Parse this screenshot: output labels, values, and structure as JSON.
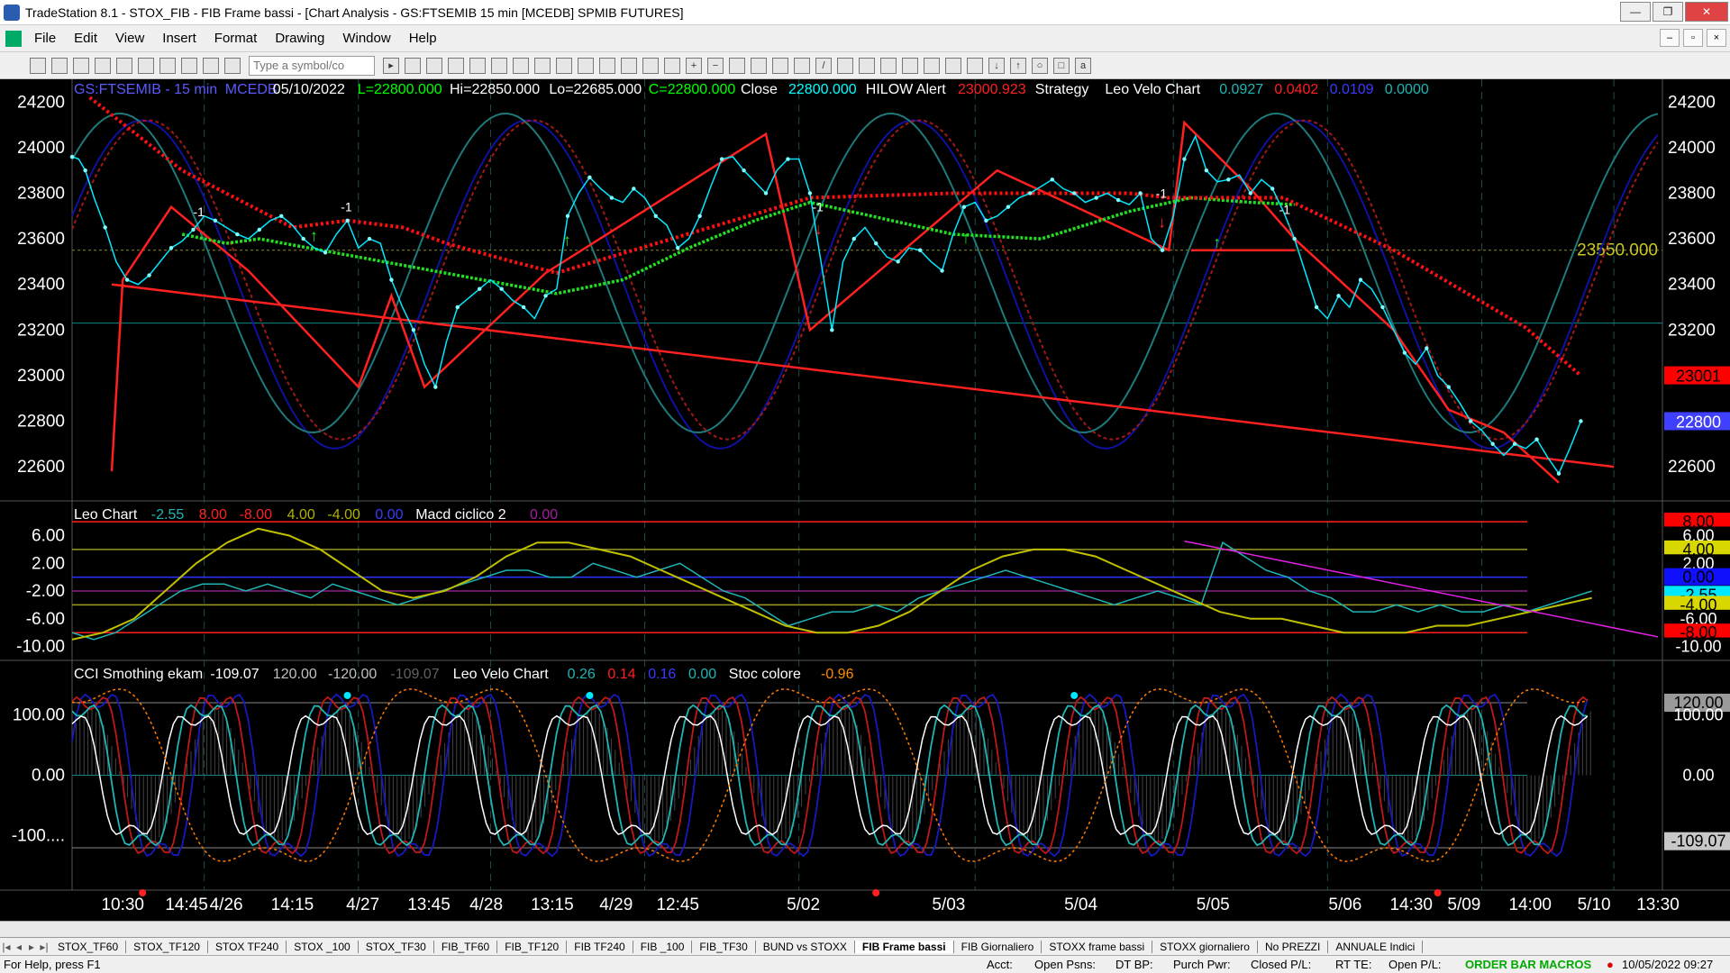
{
  "window": {
    "title": "TradeStation 8.1 - STOX_FIB - FIB Frame bassi - [Chart Analysis - GS:FTSEMIB 15 min  [MCEDB] SPMIB FUTURES]",
    "min_label": "—",
    "max_label": "❐",
    "close_label": "✕"
  },
  "menu": [
    "File",
    "Edit",
    "View",
    "Insert",
    "Format",
    "Drawing",
    "Window",
    "Help"
  ],
  "toolbar": {
    "symbol_placeholder": "Type a symbol/co"
  },
  "price_pane": {
    "header": [
      {
        "t": "GS:FTSEMIB - 15 min",
        "c": "#5a5aff"
      },
      {
        "t": "MCEDB",
        "c": "#5a5aff"
      },
      {
        "t": "05/10/2022",
        "c": "#ffffff"
      },
      {
        "t": "L=22800.000",
        "c": "#00ff00"
      },
      {
        "t": "Hi=22850.000",
        "c": "#ffffff"
      },
      {
        "t": "Lo=22685.000",
        "c": "#ffffff"
      },
      {
        "t": "C=22800.000",
        "c": "#00ff00"
      },
      {
        "t": "Close",
        "c": "#ffffff"
      },
      {
        "t": "22800.000",
        "c": "#00ffff"
      },
      {
        "t": "HILOW Alert",
        "c": "#ffffff"
      },
      {
        "t": "23000.923",
        "c": "#ff2020"
      },
      {
        "t": "Strategy",
        "c": "#ffffff"
      },
      {
        "t": "Leo Velo Chart",
        "c": "#ffffff"
      },
      {
        "t": "0.0927",
        "c": "#1fb5b5"
      },
      {
        "t": "0.0402",
        "c": "#ff2020"
      },
      {
        "t": "0.0109",
        "c": "#3a3aff"
      },
      {
        "t": "0.0000",
        "c": "#1fb5b5"
      }
    ],
    "y_ticks": [
      "24200",
      "24000",
      "23800",
      "23600",
      "23400",
      "23200",
      "23000",
      "22800",
      "22600"
    ],
    "y_range": [
      22450,
      24300
    ],
    "level_label": "23550.000",
    "level_value": 23550,
    "marker_hilow": "23001",
    "marker_close": "22800"
  },
  "osc_pane": {
    "header": [
      {
        "t": "Leo Chart",
        "c": "#ffffff"
      },
      {
        "t": "-2.55",
        "c": "#1fb5b5"
      },
      {
        "t": "8.00",
        "c": "#ff2020"
      },
      {
        "t": "-8.00",
        "c": "#ff2020"
      },
      {
        "t": "4.00",
        "c": "#b0b000"
      },
      {
        "t": "-4.00",
        "c": "#b0b000"
      },
      {
        "t": "0.00",
        "c": "#3a3aff"
      },
      {
        "t": "Macd ciclico 2",
        "c": "#ffffff"
      },
      {
        "t": "0.00",
        "c": "#a020a0"
      }
    ],
    "y_ticks": [
      "6.00",
      "2.00",
      "-2.00",
      "-6.00",
      "-10.00"
    ],
    "y_range": [
      -12,
      11
    ],
    "right_tags": [
      {
        "t": "8.00",
        "bg": "#ff0000",
        "fg": "#000000",
        "v": 8
      },
      {
        "t": "6.00",
        "bg": "#000000",
        "fg": "#ffffff",
        "v": 6
      },
      {
        "t": "4.00",
        "bg": "#d8d800",
        "fg": "#000000",
        "v": 4
      },
      {
        "t": "2.00",
        "bg": "#000000",
        "fg": "#ffffff",
        "v": 2
      },
      {
        "t": "0.00",
        "bg": "#1010ff",
        "fg": "#000000",
        "v": 0
      },
      {
        "t": "-2.55",
        "bg": "#00e8ff",
        "fg": "#000000",
        "v": -2.55
      },
      {
        "t": "-4.00",
        "bg": "#d8d800",
        "fg": "#000000",
        "v": -4
      },
      {
        "t": "-6.00",
        "bg": "#000000",
        "fg": "#ffffff",
        "v": -6
      },
      {
        "t": "-8.00",
        "bg": "#ff0000",
        "fg": "#000000",
        "v": -8
      },
      {
        "t": "-10.00",
        "bg": "#000000",
        "fg": "#ffffff",
        "v": -10
      }
    ]
  },
  "cci_pane": {
    "header": [
      {
        "t": "CCI Smothing ekam",
        "c": "#ffffff"
      },
      {
        "t": "-109.07",
        "c": "#ffffff"
      },
      {
        "t": "120.00",
        "c": "#c0c0c0"
      },
      {
        "t": "-120.00",
        "c": "#c0c0c0"
      },
      {
        "t": "-109.07",
        "c": "#606060"
      },
      {
        "t": "Leo Velo Chart",
        "c": "#ffffff"
      },
      {
        "t": "0.26",
        "c": "#1fb5b5"
      },
      {
        "t": "0.14",
        "c": "#ff2020"
      },
      {
        "t": "0.16",
        "c": "#3a3aff"
      },
      {
        "t": "0.00",
        "c": "#1fb5b5"
      },
      {
        "t": "Stoc colore",
        "c": "#ffffff"
      },
      {
        "t": "-0.96",
        "c": "#ff8c00"
      }
    ],
    "y_ticks": [
      "100.00",
      "0.00",
      "-100...."
    ],
    "y_range": [
      -190,
      190
    ],
    "right_tags": [
      {
        "t": "120.00",
        "v": 120
      },
      {
        "t": "100.00",
        "v": 100
      },
      {
        "t": "0.00",
        "v": 0
      },
      {
        "t": "-109.07",
        "v": -109.07
      }
    ]
  },
  "x_labels": [
    "10:30",
    "14:45",
    "4/26",
    "14:15",
    "4/27",
    "13:45",
    "4/28",
    "13:15",
    "4/29",
    "12:45",
    "5/02",
    "5/03",
    "5/04",
    "5/05",
    "5/06",
    "14:30",
    "5/09",
    "14:00",
    "5/10",
    "13:30"
  ],
  "tabs": [
    "STOX_TF60",
    "STOX_TF120",
    "STOX TF240",
    "STOX _100",
    "STOX_TF30",
    "FIB_TF60",
    "FIB_TF120",
    "FIB TF240",
    "FIB _100",
    "FIB_TF30",
    "BUND vs STOXX",
    "FIB Frame bassi",
    "FIB Giornaliero",
    "STOXX frame bassi",
    "STOXX giornaliero",
    "No PREZZI",
    "ANNUALE Indici"
  ],
  "active_tab": "FIB Frame bassi",
  "status": {
    "help": "For Help, press F1",
    "acct": "Acct:",
    "open_psns": "Open Psns:",
    "dt_bp": "DT BP:",
    "purch_pwr": "Purch Pwr:",
    "closed_pl": "Closed P/L:",
    "rt_te": "RT TE:",
    "open_pl": "Open P/L:",
    "macros": "ORDER BAR  MACROS",
    "datetime": "10/05/2022 09:27"
  },
  "chart_data": {
    "type": "line",
    "symbol": "GS:FTSEMIB",
    "price_close_path": [
      [
        0,
        23960
      ],
      [
        0.3,
        23950
      ],
      [
        0.6,
        23900
      ],
      [
        1,
        23780
      ],
      [
        1.5,
        23650
      ],
      [
        2,
        23500
      ],
      [
        2.5,
        23420
      ],
      [
        3,
        23400
      ],
      [
        3.5,
        23440
      ],
      [
        4,
        23500
      ],
      [
        4.5,
        23560
      ],
      [
        5,
        23590
      ],
      [
        5.5,
        23640
      ],
      [
        6,
        23700
      ],
      [
        6.5,
        23680
      ],
      [
        7,
        23650
      ],
      [
        7.5,
        23620
      ],
      [
        8,
        23600
      ],
      [
        8.5,
        23640
      ],
      [
        9,
        23680
      ],
      [
        9.5,
        23700
      ],
      [
        10,
        23660
      ],
      [
        10.5,
        23600
      ],
      [
        11,
        23560
      ],
      [
        11.5,
        23540
      ],
      [
        12,
        23620
      ],
      [
        12.5,
        23680
      ],
      [
        13,
        23560
      ],
      [
        13.5,
        23600
      ],
      [
        14,
        23580
      ],
      [
        14.5,
        23420
      ],
      [
        15,
        23300
      ],
      [
        15.5,
        23200
      ],
      [
        16,
        23050
      ],
      [
        16.5,
        22950
      ],
      [
        17,
        23150
      ],
      [
        17.5,
        23300
      ],
      [
        18,
        23340
      ],
      [
        18.5,
        23380
      ],
      [
        19,
        23420
      ],
      [
        19.5,
        23380
      ],
      [
        20,
        23330
      ],
      [
        20.5,
        23300
      ],
      [
        21,
        23250
      ],
      [
        21.5,
        23350
      ],
      [
        22,
        23380
      ],
      [
        22.5,
        23700
      ],
      [
        23,
        23800
      ],
      [
        23.5,
        23870
      ],
      [
        24,
        23820
      ],
      [
        24.5,
        23780
      ],
      [
        25,
        23760
      ],
      [
        25.5,
        23820
      ],
      [
        26,
        23780
      ],
      [
        26.5,
        23700
      ],
      [
        27,
        23660
      ],
      [
        27.5,
        23560
      ],
      [
        28,
        23600
      ],
      [
        28.5,
        23700
      ],
      [
        29,
        23830
      ],
      [
        29.5,
        23950
      ],
      [
        30,
        23960
      ],
      [
        30.5,
        23900
      ],
      [
        31,
        23850
      ],
      [
        31.5,
        23800
      ],
      [
        32,
        23900
      ],
      [
        32.5,
        23950
      ],
      [
        33,
        23950
      ],
      [
        33.5,
        23800
      ],
      [
        34,
        23500
      ],
      [
        34.5,
        23200
      ],
      [
        35,
        23500
      ],
      [
        35.5,
        23600
      ],
      [
        36,
        23650
      ],
      [
        36.5,
        23580
      ],
      [
        37,
        23520
      ],
      [
        37.5,
        23500
      ],
      [
        38,
        23560
      ],
      [
        38.5,
        23550
      ],
      [
        39,
        23500
      ],
      [
        39.5,
        23460
      ],
      [
        40,
        23620
      ],
      [
        40.5,
        23740
      ],
      [
        41,
        23760
      ],
      [
        41.5,
        23680
      ],
      [
        42,
        23700
      ],
      [
        42.5,
        23740
      ],
      [
        43,
        23780
      ],
      [
        43.5,
        23800
      ],
      [
        44,
        23830
      ],
      [
        44.5,
        23860
      ],
      [
        45,
        23820
      ],
      [
        45.5,
        23800
      ],
      [
        46,
        23760
      ],
      [
        46.5,
        23780
      ],
      [
        47,
        23800
      ],
      [
        47.5,
        23770
      ],
      [
        48,
        23750
      ],
      [
        48.5,
        23800
      ],
      [
        49,
        23600
      ],
      [
        49.5,
        23550
      ],
      [
        50,
        23700
      ],
      [
        50.5,
        23950
      ],
      [
        51,
        24050
      ],
      [
        51.5,
        23900
      ],
      [
        52,
        23850
      ],
      [
        52.5,
        23860
      ],
      [
        53,
        23880
      ],
      [
        53.5,
        23800
      ],
      [
        54,
        23860
      ],
      [
        54.5,
        23820
      ],
      [
        55,
        23720
      ],
      [
        55.5,
        23600
      ],
      [
        56,
        23450
      ],
      [
        56.5,
        23300
      ],
      [
        57,
        23250
      ],
      [
        57.5,
        23350
      ],
      [
        58,
        23300
      ],
      [
        58.5,
        23420
      ],
      [
        59,
        23380
      ],
      [
        59.5,
        23300
      ],
      [
        60,
        23200
      ],
      [
        60.5,
        23100
      ],
      [
        61,
        23050
      ],
      [
        61.5,
        23120
      ],
      [
        62,
        23000
      ],
      [
        62.5,
        22950
      ],
      [
        63,
        22880
      ],
      [
        63.5,
        22800
      ],
      [
        64,
        22760
      ],
      [
        64.5,
        22700
      ],
      [
        65,
        22650
      ],
      [
        65.5,
        22700
      ],
      [
        66,
        22680
      ],
      [
        66.5,
        22720
      ],
      [
        67,
        22640
      ],
      [
        67.5,
        22570
      ],
      [
        68,
        22680
      ],
      [
        68.5,
        22800
      ]
    ],
    "hilow_line": [
      [
        0.8,
        24220
      ],
      [
        5,
        23900
      ],
      [
        10,
        23650
      ],
      [
        12.5,
        23680
      ],
      [
        15,
        23650
      ],
      [
        17,
        23580
      ],
      [
        20,
        23500
      ],
      [
        22,
        23450
      ],
      [
        33.5,
        23780
      ],
      [
        40,
        23800
      ],
      [
        48,
        23800
      ],
      [
        49.8,
        23780
      ],
      [
        52,
        23780
      ],
      [
        55,
        23780
      ],
      [
        60,
        23550
      ],
      [
        66,
        23210
      ],
      [
        68.5,
        23000
      ]
    ],
    "zigzag_lines": [
      [
        [
          1.8,
          22580
        ],
        [
          2.3,
          23420
        ],
        [
          4.5,
          23740
        ],
        [
          8,
          23460
        ],
        [
          13,
          22950
        ],
        [
          14.5,
          23350
        ],
        [
          16,
          22950
        ],
        [
          21.5,
          23450
        ],
        [
          31.5,
          24060
        ],
        [
          33.5,
          23200
        ],
        [
          42,
          23900
        ],
        [
          49.8,
          23550
        ],
        [
          50.5,
          24110
        ],
        [
          53.5,
          23820
        ],
        [
          55.5,
          23600
        ],
        [
          60,
          23200
        ],
        [
          62.5,
          22850
        ],
        [
          65,
          22750
        ],
        [
          67.5,
          22530
        ]
      ],
      [
        [
          1.8,
          23400
        ],
        [
          70,
          22600
        ]
      ],
      [
        [
          50.8,
          23550
        ],
        [
          55.5,
          23550
        ]
      ]
    ],
    "green_ma": [
      [
        5,
        23620
      ],
      [
        7,
        23580
      ],
      [
        8.5,
        23600
      ],
      [
        22,
        23360
      ],
      [
        25,
        23420
      ],
      [
        28,
        23560
      ],
      [
        31,
        23680
      ],
      [
        33.5,
        23760
      ],
      [
        40,
        23620
      ],
      [
        44,
        23600
      ],
      [
        48,
        23720
      ],
      [
        50.8,
        23780
      ],
      [
        53.5,
        23760
      ],
      [
        55.5,
        23750
      ]
    ],
    "oscillator_series": [
      {
        "name": "Leo Chart",
        "color": "#1fb5b5",
        "values": [
          -8,
          -9,
          -8,
          -6,
          -4,
          -2,
          -1,
          -1,
          -2,
          -1,
          -2,
          -3,
          -1,
          -2,
          -3,
          -4,
          -3,
          -2,
          -1,
          0,
          1,
          1,
          0,
          0,
          2,
          1,
          0,
          1,
          2,
          0,
          -2,
          -3,
          -5,
          -7,
          -6,
          -5,
          -5,
          -4,
          -5,
          -3,
          -2,
          -1,
          0,
          1,
          0,
          -1,
          -2,
          -3,
          -4,
          -3,
          -2,
          -3,
          -4,
          5,
          3,
          1,
          0,
          -2,
          -3,
          -5,
          -5,
          -4,
          -5,
          -4,
          -5,
          -5,
          -4,
          -5,
          -4,
          -3,
          -2
        ]
      },
      {
        "name": "Macd ciclico 2",
        "color": "#c0c000",
        "values": [
          -9,
          -8,
          -6,
          -2,
          2,
          5,
          7,
          6,
          4,
          1,
          -2,
          -3,
          -2,
          0,
          3,
          5,
          5,
          4,
          3,
          1,
          -1,
          -3,
          -5,
          -7,
          -8,
          -8,
          -7,
          -5,
          -2,
          1,
          3,
          4,
          4,
          3,
          1,
          -1,
          -3,
          -5,
          -6,
          -6,
          -7,
          -8,
          -8,
          -8,
          -7,
          -7,
          -6,
          -5,
          -4,
          -3
        ]
      }
    ],
    "osc_magenta_line": [
      [
        50.5,
        5.2
      ],
      [
        72,
        -8.6
      ]
    ],
    "cci_series": [
      {
        "name": "CCI Smothing ekam",
        "color": "#ffffff"
      },
      {
        "name": "Leo Velo Chart",
        "color": "#1fb5b5"
      },
      {
        "name": "Stoc colore",
        "color": "#ff8c00"
      }
    ],
    "ylim_price": [
      22450,
      24300
    ],
    "ylim_osc": [
      -12,
      11
    ],
    "ylim_cci": [
      -190,
      190
    ]
  }
}
